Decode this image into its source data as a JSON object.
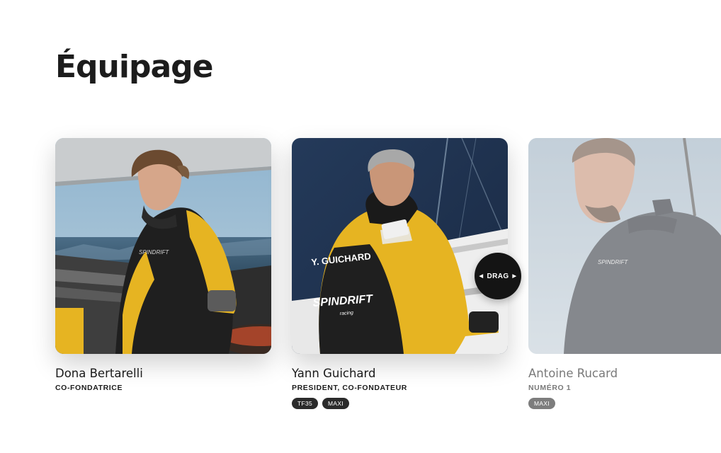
{
  "section": {
    "title": "Équipage"
  },
  "crew": [
    {
      "name": "Dona Bertarelli",
      "role": "CO-FONDATRICE",
      "tags": [],
      "jacket_print": "SPINDRIFT"
    },
    {
      "name": "Yann Guichard",
      "role": "PRESIDENT, CO-FONDATEUR",
      "tags": [
        "TF35",
        "MAXI"
      ],
      "jacket_print": "Y. GUICHARD",
      "jacket_logo": "SPINDRIFT",
      "jacket_logo_sub": "racing"
    },
    {
      "name": "Antoine Rucard",
      "role": "NUMÉRO 1",
      "tags": [
        "MAXI"
      ],
      "jacket_print": "SPINDRIFT"
    }
  ],
  "drag_cursor": {
    "label": "DRAG",
    "left_icon": "chevron-left-icon",
    "right_icon": "chevron-right-icon"
  },
  "colors": {
    "text": "#1c1c1c",
    "tag_bg": "#2b2b2b",
    "drag_bg": "#141414",
    "jacket_yellow": "#e6b422"
  }
}
